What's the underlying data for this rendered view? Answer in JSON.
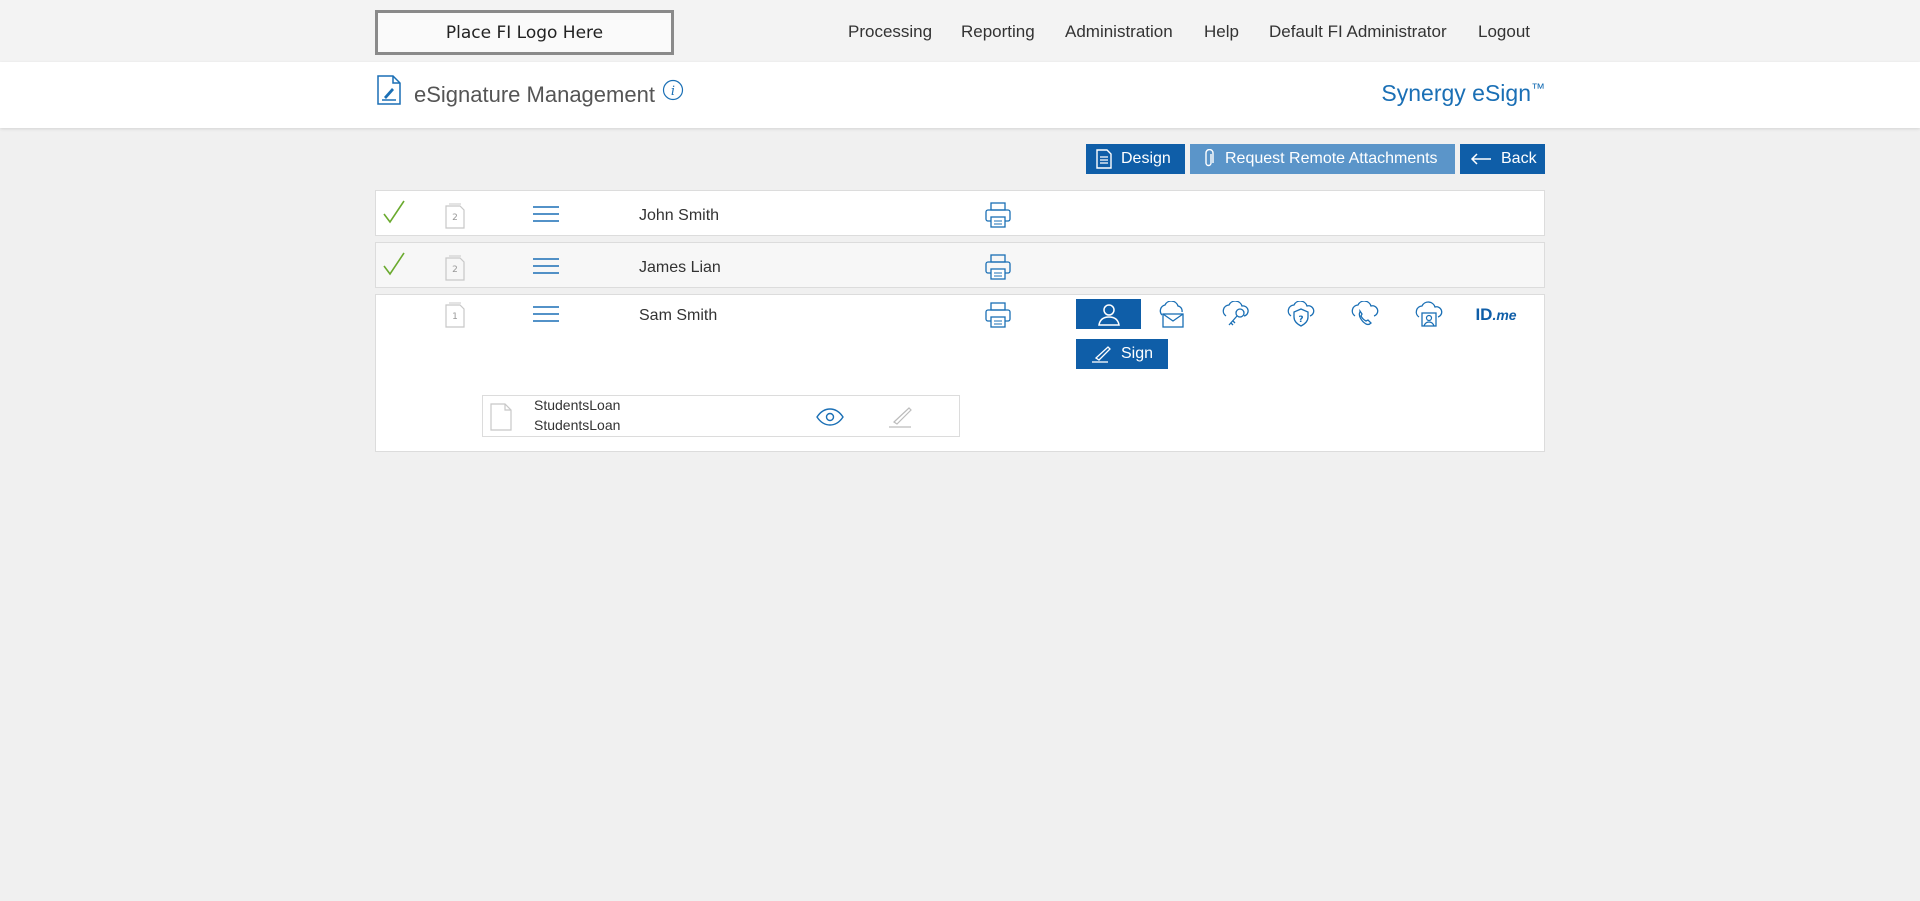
{
  "topbar": {
    "logo_text": "Place FI Logo Here",
    "nav": [
      "Processing",
      "Reporting",
      "Administration",
      "Help",
      "Default FI Administrator",
      "Logout"
    ]
  },
  "header": {
    "title": "eSignature Management",
    "brand": "Synergy eSign",
    "brand_mark": "™"
  },
  "actions": {
    "design": "Design",
    "remote": "Request Remote Attachments",
    "back": "Back"
  },
  "signers": [
    {
      "name": "John Smith",
      "doc_count": "2",
      "status": "signed"
    },
    {
      "name": "James Lian",
      "doc_count": "2",
      "status": "signed"
    },
    {
      "name": "Sam Smith",
      "doc_count": "1",
      "status": "pending"
    }
  ],
  "auth_methods": [
    "in-person-icon",
    "email-icon",
    "key-icon",
    "security-question-icon",
    "phone-icon",
    "cloud-person-icon",
    "idme-icon"
  ],
  "idme": {
    "id": "ID",
    "me": ".me"
  },
  "sign_label": "Sign",
  "document": {
    "line1": "StudentsLoan",
    "line2": "StudentsLoan"
  },
  "colors": {
    "accent": "#0f5ea8",
    "accent_light": "#5b95c9",
    "check": "#6aaa2e",
    "brand": "#1a6fb5"
  }
}
